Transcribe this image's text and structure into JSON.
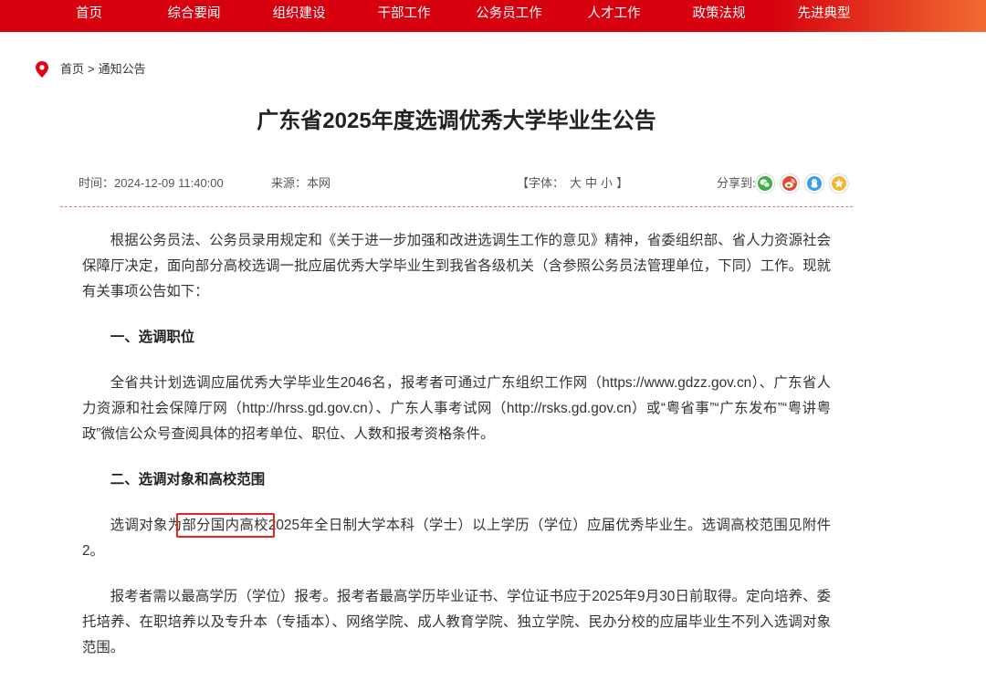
{
  "theme": {
    "nav-start": "#d6000e",
    "nav-end": "#f26b31",
    "accent": "#e60012",
    "rule": "#e8796c",
    "annotation": "#e8231b"
  },
  "nav": {
    "items": [
      {
        "label": "首页"
      },
      {
        "label": "综合要闻"
      },
      {
        "label": "组织建设"
      },
      {
        "label": "干部工作"
      },
      {
        "label": "公务员工作"
      },
      {
        "label": "人才工作"
      },
      {
        "label": "政策法规"
      },
      {
        "label": "先进典型"
      }
    ]
  },
  "breadcrumb": {
    "icon": "location-pin-icon",
    "home": "首页",
    "separator": ">",
    "current": "通知公告"
  },
  "article": {
    "title": "广东省2025年度选调优秀大学毕业生公告",
    "meta": {
      "time": "时间：2024-12-09 11:40:00",
      "source": "来源：本网",
      "font_open": "【字体：",
      "font_sizes": [
        "大",
        "中",
        "小"
      ],
      "font_close": "】",
      "share_label": "分享到:"
    },
    "share": [
      {
        "icon": "wechat-icon",
        "color": "#3dae3f"
      },
      {
        "icon": "weibo-icon",
        "color": "#e8452c"
      },
      {
        "icon": "qq-icon",
        "color": "#3b9ee8"
      },
      {
        "icon": "qzone-icon",
        "color": "#f5b52e"
      }
    ],
    "intro": "根据公务员法、公务员录用规定和《关于进一步加强和改进选调生工作的意见》精神，省委组织部、省人力资源社会保障厅决定，面向部分高校选调一批应届优秀大学毕业生到我省各级机关（含参照公务员法管理单位，下同）工作。现就有关事项公告如下：",
    "sections": [
      {
        "heading": "一、选调职位",
        "paragraphs": [
          {
            "text": "全省共计划选调应届优秀大学毕业生2046名，报考者可通过广东组织工作网（https://www.gdzz.gov.cn）、广东省人力资源和社会保障厅网（http://hrss.gd.gov.cn）、广东人事考试网（http://rsks.gd.gov.cn）或“粤省事”“广东发布”“粤讲粤政”微信公众号查阅具体的招考单位、职位、人数和报考资格条件。"
          }
        ]
      },
      {
        "heading": "二、选调对象和高校范围",
        "paragraphs": [
          {
            "before": "选调对象为",
            "highlight": "部分国内高校",
            "after": "2025年全日制大学本科（学士）以上学历（学位）应届优秀毕业生。选调高校范围见附件2。"
          },
          {
            "text": "报考者需以最高学历（学位）报考。报考者最高学历毕业证书、学位证书应于2025年9月30日前取得。定向培养、委托培养、在职培养以及专升本（专插本）、网络学院、成人教育学院、独立学院、民办分校的应届毕业生不列入选调对象范围。"
          }
        ]
      }
    ]
  }
}
